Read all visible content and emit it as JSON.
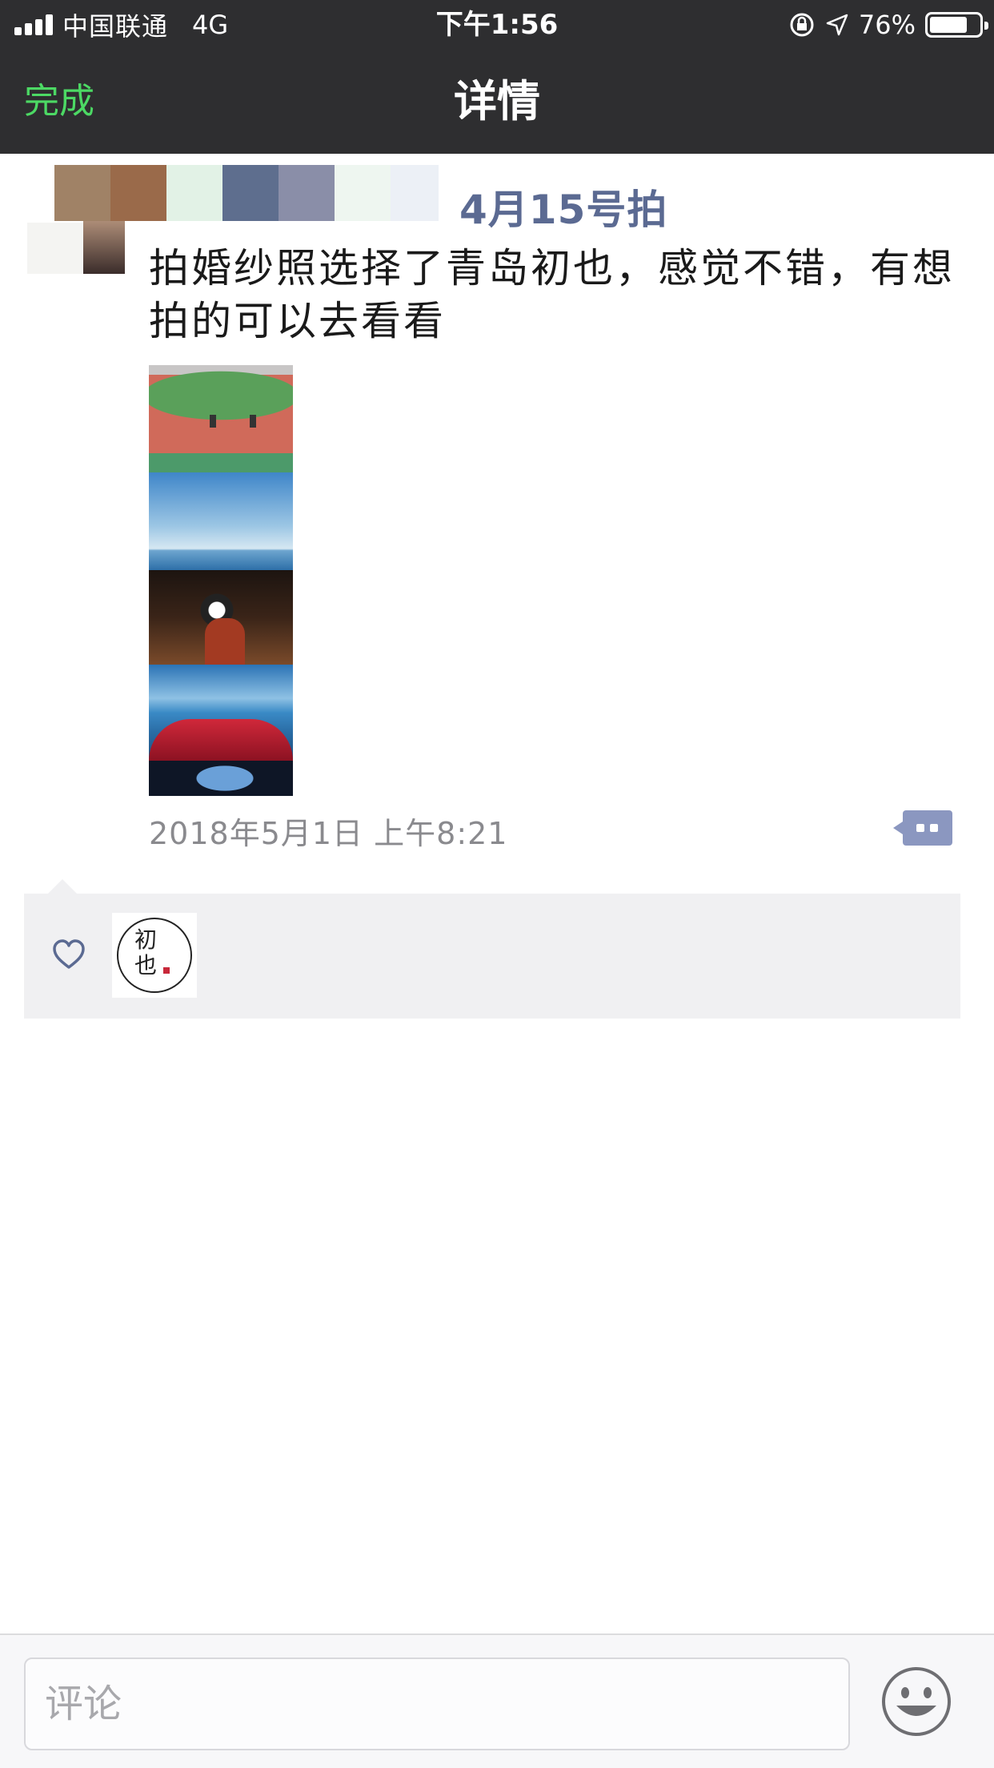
{
  "status_bar": {
    "carrier": "中国联通",
    "network": "4G",
    "time": "下午1:56",
    "battery_percent": "76%",
    "battery_level": 0.76
  },
  "nav": {
    "back_label": "完成",
    "title": "详情"
  },
  "post": {
    "username_visible": "4月15号拍",
    "text": "拍婚纱照选择了青岛初也，感觉不错，有想拍的可以去看看",
    "timestamp": "2018年5月1日 上午8:21",
    "likes": [
      {
        "avatar_text": "初也"
      }
    ]
  },
  "comment_bar": {
    "placeholder": "评论"
  },
  "colors": {
    "nav_bg": "#2e2e30",
    "done_green": "#4cd964",
    "username_blue": "#5b6a92",
    "comment_btn": "#8b97c0",
    "likes_bg": "#f0f0f2"
  },
  "icons": {
    "signal": "signal-bars-icon",
    "rotation_lock": "rotation-lock-icon",
    "location": "location-arrow-icon",
    "battery": "battery-icon",
    "comment": "comment-action-icon",
    "like": "heart-icon",
    "emoji": "emoji-smile-icon"
  }
}
